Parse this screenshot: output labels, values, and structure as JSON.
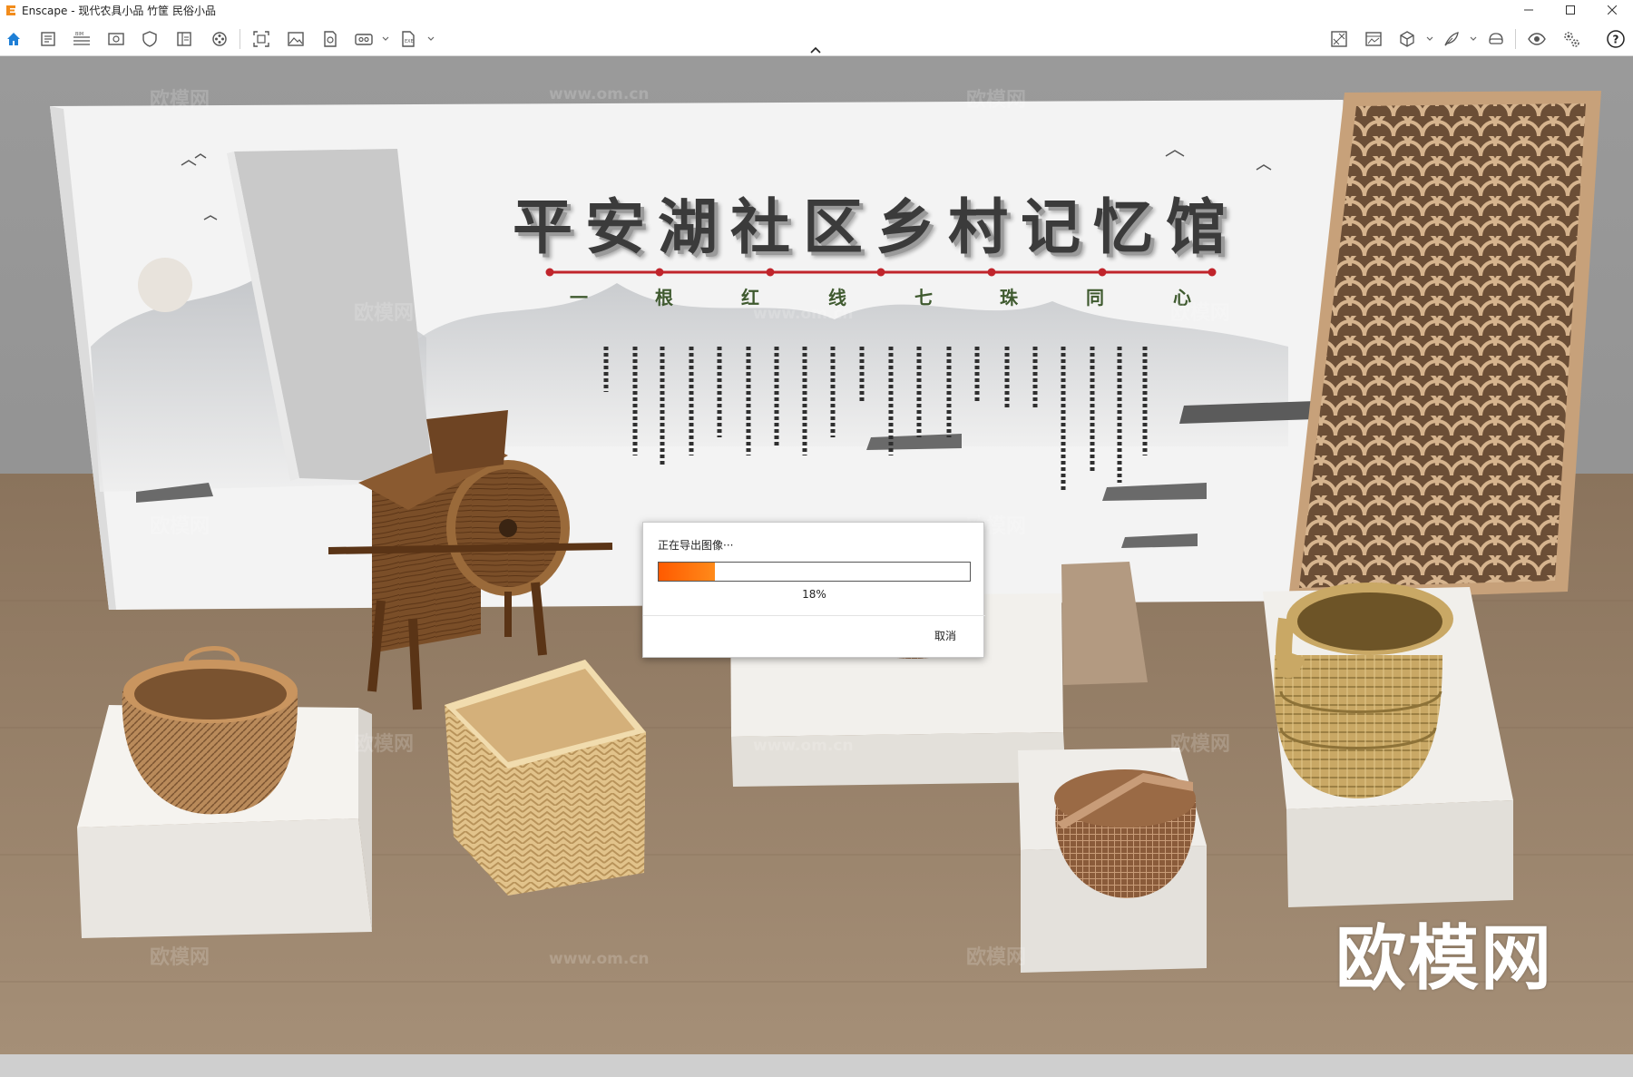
{
  "window": {
    "title": "Enscape - 现代农具小品 竹筐 民俗小品"
  },
  "toolbar": {
    "left_icons": [
      "home-icon",
      "document-icon",
      "bim-icon",
      "preview-window-icon",
      "shield-icon",
      "book-icon",
      "video-icon",
      "screenshot-icon",
      "image-icon",
      "batch-render-icon",
      "panorama-icon",
      "export-icon"
    ],
    "right_icons": [
      "asset-library-icon",
      "material-icon",
      "cube-icon",
      "feather-icon",
      "vr-icon",
      "visual-settings-icon",
      "general-settings-icon",
      "help-icon"
    ]
  },
  "scene": {
    "banner_title": "平安湖社区乡村记忆馆",
    "banner_subtitle": [
      "一",
      "根",
      "红",
      "线",
      "七",
      "珠",
      "同",
      "心"
    ],
    "watermark_small": "欧模网",
    "watermark_url": "www.om.cn",
    "watermark_big": "欧模网"
  },
  "dialog": {
    "title": "正在导出图像···",
    "progress_percent": 18,
    "progress_label": "18%",
    "cancel_label": "取消",
    "accent_color": "#ff6a00"
  }
}
